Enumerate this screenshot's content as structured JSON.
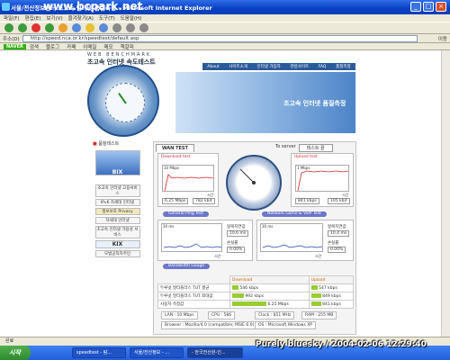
{
  "window": {
    "title": "서울/전산정보센터 초고속 인터넷 품질측정 - Microsoft Internet Explorer",
    "watermark": "www.bcpark.net"
  },
  "menu": [
    "파일(F)",
    "편집(E)",
    "보기(V)",
    "즐겨찾기(A)",
    "도구(T)",
    "도움말(H)"
  ],
  "address": {
    "label": "주소(D)",
    "url": "http://speed.nca.or.kr/speedtest/default.asp",
    "go_label": "이동"
  },
  "links": {
    "brand": "NAVER",
    "items": [
      "검색",
      "블로그",
      "카페",
      "이메일",
      "메모",
      "책갈피"
    ]
  },
  "banner": {
    "brand_en": "WEB BENCHMARK",
    "brand_kr": "초고속 인터넷 속도테스트",
    "nav": [
      "About",
      "사이트소개",
      "인터넷 가입자",
      "관련사이트",
      "FAQ",
      "품질측정"
    ],
    "slogan": "초고속 인터넷 품질측정"
  },
  "sidebar": {
    "heading": "품질테스트",
    "items": [
      "BIX",
      "초고속 인터넷 고용서비스",
      "IPv6 차세대 인터넷",
      "정보보호 Privacy",
      "차세대 인터넷",
      "초고속 인터넷 가용성 서비스",
      "KIX",
      "모범공직자주민"
    ]
  },
  "test": {
    "tab": "WAN TEST",
    "to_server_label": "To server",
    "server": "테스트 끝",
    "download": {
      "label": "Download test",
      "axis_unit": "10 Mbps",
      "time_label": "시간",
      "speed": "6.25 Mbps",
      "data": "782 kbit"
    },
    "upload": {
      "label": "Upload test",
      "axis_unit": "1 Mbps",
      "time_label": "시간",
      "speed": "841 kbps",
      "data": "105 kbit"
    },
    "ping_button": "General Ping Test",
    "voip_button": "Network Game & VoIP Test",
    "ping": {
      "axis_unit": "30 ms",
      "time_label": "시간",
      "avg_label": "왕복지연값",
      "avg": "10.6 ms",
      "loss_label": "손실률",
      "loss": "0.00%"
    },
    "voip": {
      "axis_unit": "30 ms",
      "time_label": "시간",
      "avg_label": "왕복지연값",
      "avg": "10.4 ms",
      "loss_label": "손실률",
      "loss": "0.00%"
    },
    "bandwidth_button": "Bandwidth Gauge",
    "results": {
      "head_download": "Download",
      "head_upload": "Upload",
      "rows": [
        {
          "label": "두루넷 멀티플러스 TUT 평균",
          "down": "546 kbps",
          "up": "547 kbps",
          "down_pct": 0.18,
          "up_pct": 0.18
        },
        {
          "label": "두루넷 멀티플러스 TUT 최대값",
          "down": "992 kbps",
          "up": "849 kbps",
          "down_pct": 0.32,
          "up_pct": 0.28
        },
        {
          "label": "사용자 측정값",
          "down": "6.25 Mbps",
          "up": "841 kbps",
          "down_pct": 0.95,
          "up_pct": 0.28
        }
      ]
    },
    "specs": {
      "lan_label": "LAN",
      "lan": "10 Mbps",
      "cpu_label": "CPU",
      "cpu": "586",
      "clock_label": "Clock",
      "clock": "851 MHz",
      "ram_label": "RAM",
      "ram": "255 MB",
      "browser_label": "Browser",
      "browser": "Mozilla/4.0 (compatible; MSIE 6.0)",
      "os_label": "OS",
      "os": "Microsoft Windows XP"
    }
  },
  "status_bar": "완료",
  "taskbar": {
    "start": "시작",
    "tasks": [
      "speedtest - 탐...",
      "서울/전산정보 - ...",
      "- 한국전산원-인..."
    ],
    "signature": "Purely bluesky / 2004-02-06 12:29:40"
  },
  "colors": {
    "accent": "#2a5a9a",
    "bar": "#99cc33"
  }
}
